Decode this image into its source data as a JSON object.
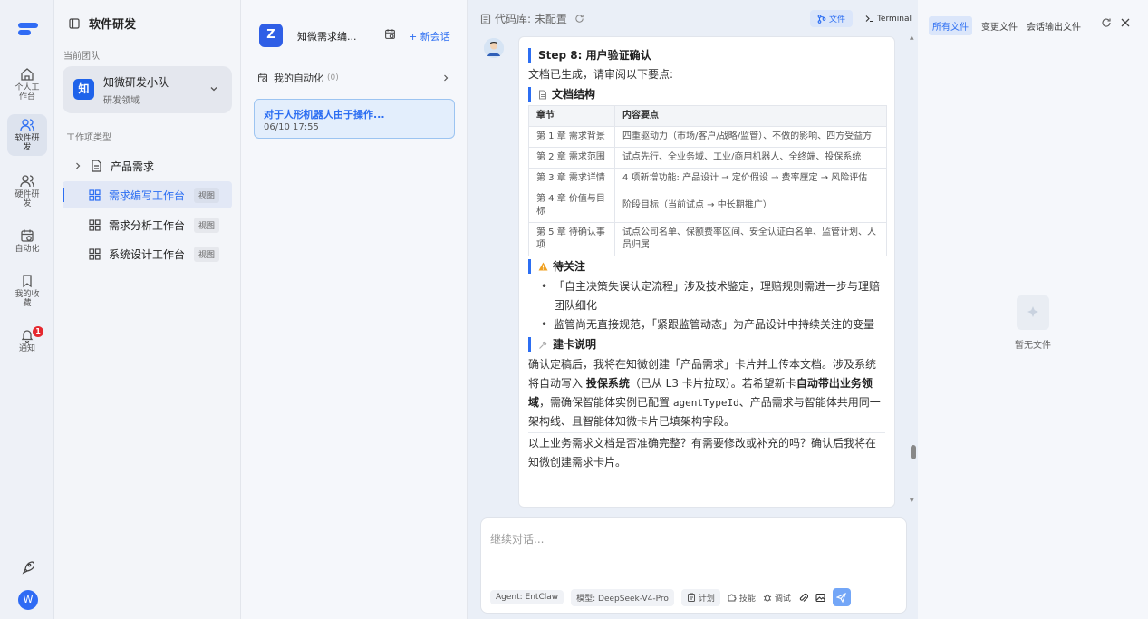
{
  "rail": {
    "items": [
      {
        "label": "个人工作台",
        "icon": "home-icon"
      },
      {
        "label": "软件研发",
        "icon": "people-icon"
      },
      {
        "label": "硬件研发",
        "icon": "people-icon"
      },
      {
        "label": "自动化",
        "icon": "calendar-clock-icon"
      },
      {
        "label": "我的收藏",
        "icon": "bookmark-icon"
      },
      {
        "label": "通知",
        "icon": "bell-icon",
        "badge": "1"
      }
    ],
    "avatar_initial": "W"
  },
  "nav": {
    "title": "软件研发",
    "team_label": "当前团队",
    "team": {
      "logo": "知",
      "name": "知微研发小队",
      "subtitle": "研发领域"
    },
    "section_label": "工作项类型",
    "items": [
      {
        "label": "产品需求"
      },
      {
        "label": "需求编写工作台",
        "tag": "视图"
      },
      {
        "label": "需求分析工作台",
        "tag": "视图"
      },
      {
        "label": "系统设计工作台",
        "tag": "视图"
      }
    ]
  },
  "sessions": {
    "app_logo": "Z",
    "app_name": "知微需求编...",
    "new_label": "+ 新会话",
    "automation_label": "我的自动化",
    "automation_count": "(0)",
    "active": {
      "title": "对于人形机器人由于操作...",
      "time": "06/10 17:55"
    }
  },
  "chat": {
    "repo_label": "代码库: 未配置",
    "files_btn": "文件",
    "terminal_btn": "Terminal",
    "message": {
      "step_title": "Step 8: 用户验证确认",
      "intro": "文档已生成，请审阅以下要点:",
      "structure_title": "文档结构",
      "table_headers": [
        "章节",
        "内容要点"
      ],
      "table_rows": [
        [
          "第 1 章 需求背景",
          "四重驱动力（市场/客户/战略/监管）、不做的影响、四方受益方"
        ],
        [
          "第 2 章 需求范围",
          "试点先行、全业务域、工业/商用机器人、全终端、投保系统"
        ],
        [
          "第 3 章 需求详情",
          "4 项新增功能: 产品设计 → 定价假设 → 费率厘定 → 风险评估"
        ],
        [
          "第 4 章 价值与目标",
          "阶段目标（当前试点 → 中长期推广）"
        ],
        [
          "第 5 章 待确认事项",
          "试点公司名单、保额费率区间、安全认证白名单、监管计划、人员归属"
        ]
      ],
      "attention_title": "待关注",
      "attention_items": [
        "「自主决策失误认定流程」涉及技术鉴定，理赔规则需进一步与理赔团队细化",
        "监管尚无直接规范，「紧跟监管动态」为产品设计中持续关注的变量"
      ],
      "card_title": "建卡说明",
      "card_p1": "确认定稿后，我将在知微创建「产品需求」卡片并上传本文档。涉及系统将自动写入",
      "card_b1": "投保系统",
      "card_p2": "（已从 L3 卡片拉取）。若希望新卡",
      "card_b2": "自动带出业务领域",
      "card_p3": "，需确保智能体实例已配置",
      "card_code": "agentTypeId",
      "card_p4": "、产品需求与智能体共用同一架构线、且智能体知微卡片已填架构字段。",
      "closing": "以上业务需求文档是否准确完整？有需要修改或补充的吗？确认后我将在知微创建需求卡片。"
    },
    "input_placeholder": "继续对话...",
    "chips": {
      "agent": "Agent: EntClaw",
      "model": "模型: DeepSeek-V4-Pro",
      "plan": "计划",
      "skill": "技能",
      "debug": "调试"
    }
  },
  "files": {
    "tabs": [
      "所有文件",
      "变更文件",
      "会话输出文件"
    ],
    "empty_text": "暂无文件"
  },
  "colors": {
    "accent": "#2c6ef2",
    "badge": "#e5282f"
  }
}
